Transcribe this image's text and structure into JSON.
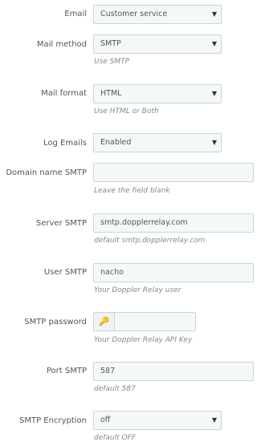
{
  "fields": {
    "email": {
      "label": "Email",
      "value": "Customer service"
    },
    "mail_method": {
      "label": "Mail method",
      "value": "SMTP",
      "hint": "Use SMTP"
    },
    "mail_format": {
      "label": "Mail format",
      "value": "HTML",
      "hint": "Use HTML or Both"
    },
    "log_emails": {
      "label": "Log Emails",
      "value": "Enabled"
    },
    "domain_name": {
      "label": "Domain name SMTP",
      "value": "",
      "hint": "Leave the field blank"
    },
    "server": {
      "label": "Server SMTP",
      "value": "smtp.dopplerrelay.com",
      "hint": "default smtp.dopplerrelay.com"
    },
    "user": {
      "label": "User SMTP",
      "value": "nacho",
      "hint": "Your Doppler Relay user"
    },
    "password": {
      "label": "SMTP password",
      "value": "",
      "hint": "Your Doppler Relay API Key"
    },
    "port": {
      "label": "Port SMTP",
      "value": "587",
      "hint": "default 587"
    },
    "encryption": {
      "label": "SMTP Encryption",
      "value": "off",
      "hint": "default OFF"
    }
  },
  "icons": {
    "select_arrow": "caret-down-icon",
    "password_addon": "key-icon"
  }
}
